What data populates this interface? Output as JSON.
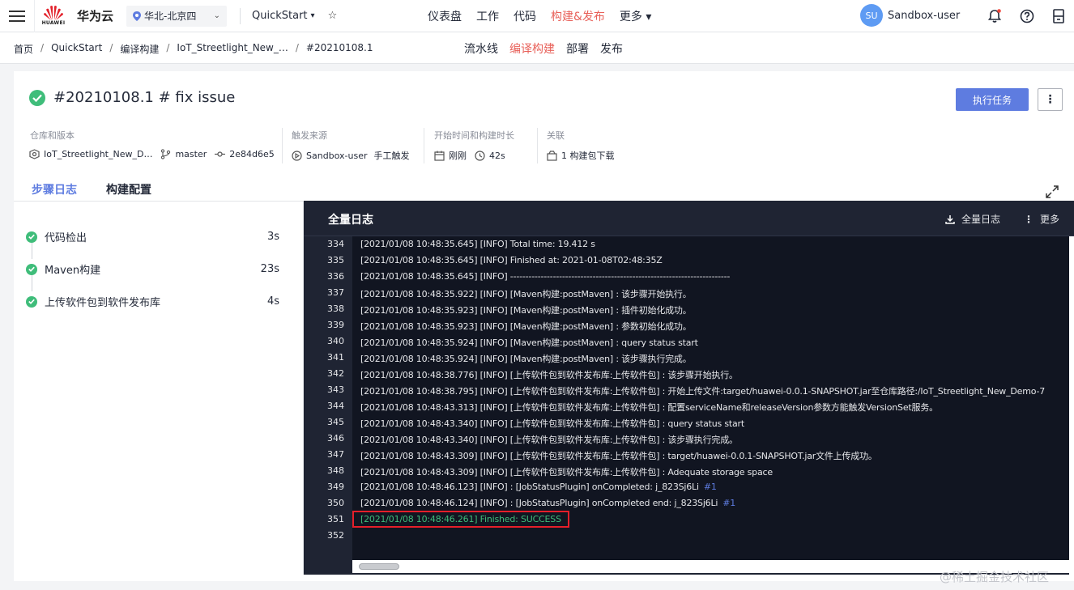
{
  "topnav": {
    "brand_name": "华为云",
    "logo_text": "HUAWEI",
    "region": "华北-北京四",
    "project": "QuickStart",
    "menu": [
      "仪表盘",
      "工作",
      "代码",
      "构建&发布",
      "更多"
    ],
    "active_menu": "构建&发布",
    "user_avatar": "SU",
    "username": "Sandbox-user",
    "icons": [
      "hamburger-icon",
      "bell-icon",
      "help-icon",
      "device-icon"
    ]
  },
  "breadcrumb": [
    "首页",
    "QuickStart",
    "编译构建",
    "IoT_Streetlight_New_…",
    "#20210108.1"
  ],
  "subtabs": [
    "流水线",
    "编译构建",
    "部署",
    "发布"
  ],
  "active_subtab": "编译构建",
  "build": {
    "title": "#20210108.1  # fix issue",
    "run_button": "执行任务",
    "more_button": "⋮",
    "meta": {
      "repo_label": "仓库和版本",
      "repo_name": "IoT_Streetlight_New_D…",
      "branch": "master",
      "commit": "2e84d6e5",
      "trigger_label": "触发来源",
      "trigger_user": "Sandbox-user",
      "trigger_type": "手工触发",
      "time_label": "开始时间和构建时长",
      "start_time": "刚刚",
      "duration": "42s",
      "related_label": "关联",
      "package": "1 构建包下载"
    }
  },
  "tabs": [
    "步骤日志",
    "构建配置"
  ],
  "active_tab": "步骤日志",
  "steps": [
    {
      "name": "代码检出",
      "time": "3s"
    },
    {
      "name": "Maven构建",
      "time": "23s"
    },
    {
      "name": "上传软件包到软件发布库",
      "time": "4s"
    }
  ],
  "log": {
    "title": "全量日志",
    "download_label": "全量日志",
    "more_label": "更多",
    "lines": [
      {
        "num": "334",
        "text": "[2021/01/08 10:48:35.645] [INFO] Total time: 19.412 s"
      },
      {
        "num": "335",
        "text": "[2021/01/08 10:48:35.645] [INFO] Finished at: 2021-01-08T02:48:35Z"
      },
      {
        "num": "336",
        "text": "[2021/01/08 10:48:35.645] [INFO] ------------------------------------------------------------------------"
      },
      {
        "num": "337",
        "text": "[2021/01/08 10:48:35.922] [INFO] [Maven构建:postMaven] : 该步骤开始执行。"
      },
      {
        "num": "338",
        "text": "[2021/01/08 10:48:35.923] [INFO] [Maven构建:postMaven] : 插件初始化成功。"
      },
      {
        "num": "339",
        "text": "[2021/01/08 10:48:35.923] [INFO] [Maven构建:postMaven] : 参数初始化成功。"
      },
      {
        "num": "340",
        "text": "[2021/01/08 10:48:35.924] [INFO] [Maven构建:postMaven] : query status start"
      },
      {
        "num": "341",
        "text": "[2021/01/08 10:48:35.924] [INFO] [Maven构建:postMaven] : 该步骤执行完成。"
      },
      {
        "num": "342",
        "text": "[2021/01/08 10:48:38.776] [INFO] [上传软件包到软件发布库:上传软件包] : 该步骤开始执行。"
      },
      {
        "num": "343",
        "text": "[2021/01/08 10:48:38.795] [INFO] [上传软件包到软件发布库:上传软件包] : 开始上传文件:target/huawei-0.0.1-SNAPSHOT.jar至仓库路径:/IoT_Streetlight_New_Demo-7"
      },
      {
        "num": "344",
        "text": "[2021/01/08 10:48:43.313] [INFO] [上传软件包到软件发布库:上传软件包] : 配置serviceName和releaseVersion参数方能触发VersionSet服务。"
      },
      {
        "num": "345",
        "text": "[2021/01/08 10:48:43.340] [INFO] [上传软件包到软件发布库:上传软件包] : query status start"
      },
      {
        "num": "346",
        "text": "[2021/01/08 10:48:43.340] [INFO] [上传软件包到软件发布库:上传软件包] : 该步骤执行完成。"
      },
      {
        "num": "347",
        "text": "[2021/01/08 10:48:43.309] [INFO] [上传软件包到软件发布库:上传软件包] : target/huawei-0.0.1-SNAPSHOT.jar文件上传成功。"
      },
      {
        "num": "348",
        "text": "[2021/01/08 10:48:43.309] [INFO] [上传软件包到软件发布库:上传软件包] : Adequate storage space"
      },
      {
        "num": "349",
        "text": "[2021/01/08 10:48:46.123] [INFO]  : [JobStatusPlugin] onCompleted: j_823Sj6Li",
        "hash": "#1"
      },
      {
        "num": "350",
        "text": "[2021/01/08 10:48:46.124] [INFO]  : [JobStatusPlugin] onCompleted end: j_823Sj6Li",
        "hash": "#1"
      },
      {
        "num": "351",
        "text": "[2021/01/08 10:48:46.261] Finished: SUCCESS",
        "status": "success"
      },
      {
        "num": "352",
        "text": ""
      }
    ]
  },
  "watermark": "@稀土掘金技术社区",
  "colors": {
    "accent": "#5e7ce0",
    "active_nav": "#e8615a",
    "success": "#3fbd7a",
    "log_bg": "#111521",
    "highlight_box": "#e51f2a"
  }
}
